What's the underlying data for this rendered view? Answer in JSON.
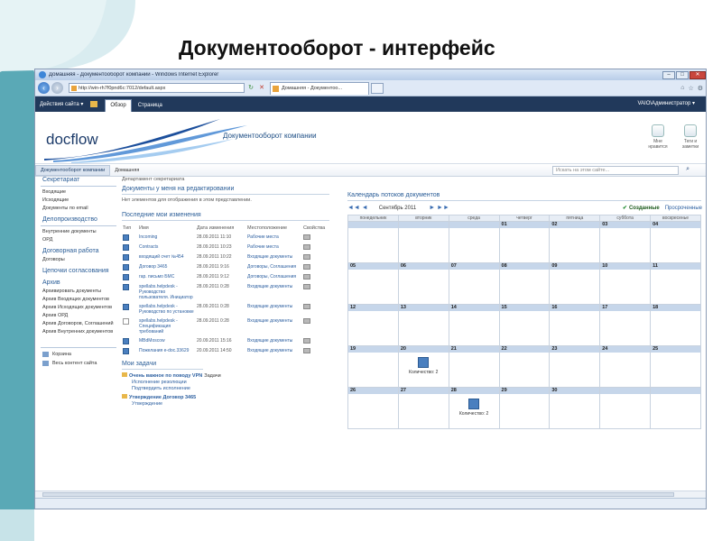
{
  "slide_title": "Документооборот - интерфейс",
  "browser": {
    "window_title": "Домашняя - Документооборот компании - Windows Internet Explorer",
    "address": "http://win-rh7f0pnd6c:7012/default.aspx",
    "tab_label": "Домашняя - Документоо...",
    "refresh_icon": "↻",
    "stop_icon": "✕",
    "min": "–",
    "max": "□",
    "close": "✕"
  },
  "ribbon": {
    "site_actions": "Действия сайта ▾",
    "tabs": [
      "Обзор",
      "Страница"
    ],
    "user": "VAIO\\Администратор ▾"
  },
  "header": {
    "logo": "docflow",
    "site_title": "Документооборот компании",
    "tools": [
      "Мне нравится",
      "Теги и заметки"
    ]
  },
  "topnav": {
    "items": [
      "Документооборот компании",
      "Домашняя"
    ],
    "search_placeholder": "Искать на этом сайте...",
    "search_icon": "⌕"
  },
  "leftnav": {
    "groups": [
      {
        "title": "Секретариат",
        "items": [
          "Входящие",
          "Исходящие",
          "Документы по email"
        ]
      },
      {
        "title": "Делопроизводство",
        "items": [
          "Внутренние документы",
          "ОРД"
        ]
      },
      {
        "title": "Договорная работа",
        "items": [
          "Договоры"
        ]
      },
      {
        "title": "Цепочки согласования",
        "items": []
      },
      {
        "title": "Архив",
        "items": [
          "Архивировать документы",
          "Архив Входящих документов",
          "Архив Исходящих документов",
          "Архив ОРД",
          "Архив Договоров, Соглашений",
          "Архив Внутренних документов"
        ]
      }
    ],
    "bottom": [
      "Корзина",
      "Весь контент сайта"
    ]
  },
  "main": {
    "breadcrumb": "Департамент секретариата",
    "editing_title": "Документы у меня на редактировании",
    "editing_empty": "Нет элементов для отображения в этом представлении.",
    "recent_title": "Последние мои изменения",
    "columns": [
      "Тип",
      "Имя",
      "Дата изменения",
      "Местоположение",
      "Свойства"
    ],
    "rows": [
      {
        "name": "Incoming",
        "date": "28.09.2011 11:10",
        "loc": "Рабочие места",
        "blank": false
      },
      {
        "name": "Contracts",
        "date": "28.09.2011 10:23",
        "loc": "Рабочие места",
        "blank": false
      },
      {
        "name": "входящий счет №454",
        "date": "28.09.2011 10:22",
        "loc": "Входящие документы",
        "blank": false
      },
      {
        "name": "Договор 3465",
        "date": "28.09.2011 9:16",
        "loc": "Договоры, Соглашения",
        "blank": false
      },
      {
        "name": "гар. письмо БМС",
        "date": "28.09.2011 9:12",
        "loc": "Договоры, Соглашения",
        "blank": false
      },
      {
        "name": "spellabs.helpdesk - Руководство пользователя. Инициатор",
        "date": "28.09.2011 0:28",
        "loc": "Входящие документы",
        "blank": false
      },
      {
        "name": "spellabs.helpdesk - Руководство по установке",
        "date": "28.09.2011 0:28",
        "loc": "Входящие документы",
        "blank": false
      },
      {
        "name": "spellabs.helpdesk - Спецификация требований",
        "date": "28.09.2011 0:28",
        "loc": "Входящие документы",
        "blank": true
      },
      {
        "name": "MBdMoscow",
        "date": "20.09.2011 15:16",
        "loc": "Входящие документы",
        "blank": false
      },
      {
        "name": "Пожелания e-doc.33629",
        "date": "20.09.2011 14:50",
        "loc": "Входящие документы",
        "blank": false
      }
    ],
    "tasks_title": "Мои задачи",
    "tasks": [
      {
        "title": "Очень важное по поводу VPN",
        "suffix": "Задачи",
        "subs": [
          "Исполнение резолюции",
          "Подтвердить исполнение"
        ]
      },
      {
        "title": "Утверждение Договор 3465",
        "suffix": "",
        "subs": [
          "Утверждение"
        ]
      }
    ]
  },
  "calendar": {
    "title": "Календарь потоков документов",
    "month": "Сентябрь 2011",
    "prev": "◄◄ ◄",
    "next": "► ►►",
    "legend_created": "Созданные",
    "legend_overdue": "Просроченные",
    "weekdays": [
      "понедельник",
      "вторник",
      "среда",
      "четверг",
      "пятница",
      "суббота",
      "воскресенье"
    ],
    "weeks": [
      [
        "",
        "",
        "",
        "01",
        "02",
        "03",
        "04"
      ],
      [
        "05",
        "06",
        "07",
        "08",
        "09",
        "10",
        "11"
      ],
      [
        "12",
        "13",
        "14",
        "15",
        "16",
        "17",
        "18"
      ],
      [
        "19",
        "20",
        "21",
        "22",
        "23",
        "24",
        "25"
      ],
      [
        "26",
        "27",
        "28",
        "29",
        "30",
        "",
        ""
      ]
    ],
    "events": [
      {
        "week": 3,
        "day": 1,
        "label": "Количество: 2"
      },
      {
        "week": 4,
        "day": 2,
        "label": "Количество: 2"
      }
    ]
  }
}
